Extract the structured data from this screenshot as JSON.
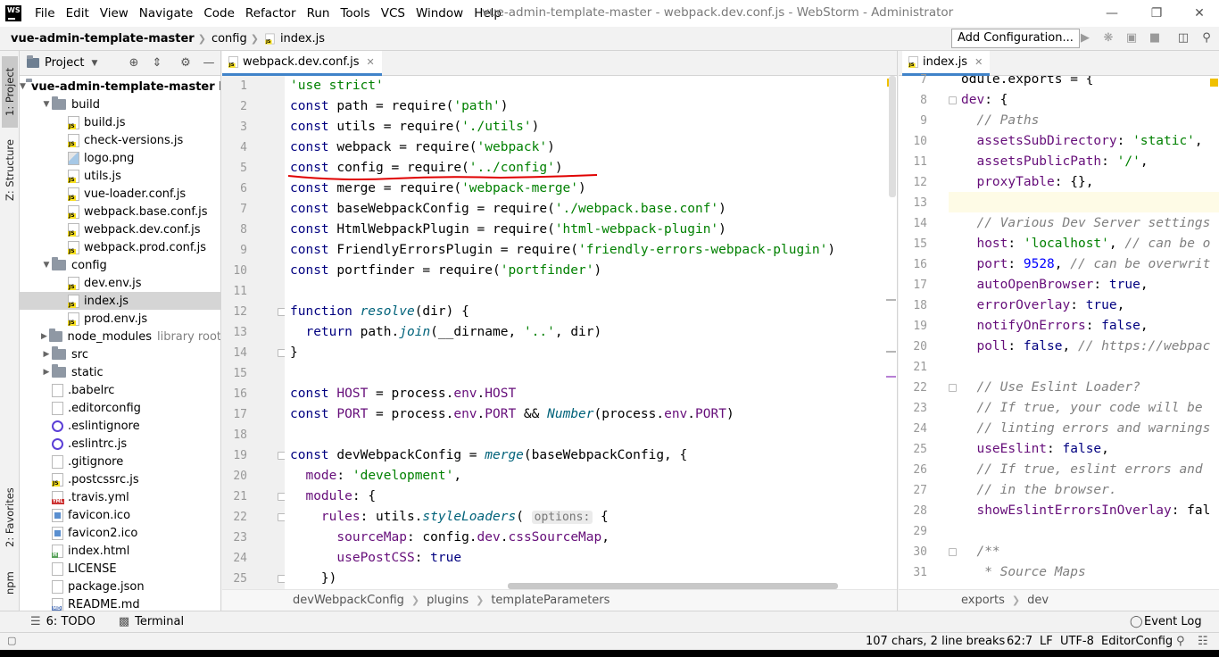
{
  "window": {
    "title": "vue-admin-template-master - webpack.dev.conf.js - WebStorm - Administrator",
    "logo_text": "WS"
  },
  "menu": [
    "File",
    "Edit",
    "View",
    "Navigate",
    "Code",
    "Refactor",
    "Run",
    "Tools",
    "VCS",
    "Window",
    "Help"
  ],
  "navbar": {
    "crumbs": [
      "vue-admin-template-master",
      "config",
      "index.js"
    ],
    "add_configuration": "Add Configuration..."
  },
  "left_strip": {
    "project_tab": "1: Project",
    "structure_tab": "Z: Structure",
    "favorites_tab": "2: Favorites",
    "npm_tab": "npm"
  },
  "project": {
    "header": "Project",
    "root": "vue-admin-template-master",
    "root_suffix": "E",
    "items": [
      {
        "label": "build",
        "type": "folder"
      },
      {
        "label": "build.js",
        "type": "js"
      },
      {
        "label": "check-versions.js",
        "type": "js"
      },
      {
        "label": "logo.png",
        "type": "img"
      },
      {
        "label": "utils.js",
        "type": "js"
      },
      {
        "label": "vue-loader.conf.js",
        "type": "js"
      },
      {
        "label": "webpack.base.conf.js",
        "type": "js"
      },
      {
        "label": "webpack.dev.conf.js",
        "type": "js"
      },
      {
        "label": "webpack.prod.conf.js",
        "type": "js"
      },
      {
        "label": "config",
        "type": "folder"
      },
      {
        "label": "dev.env.js",
        "type": "js"
      },
      {
        "label": "index.js",
        "type": "js"
      },
      {
        "label": "prod.env.js",
        "type": "js"
      },
      {
        "label": "node_modules",
        "type": "folder",
        "hint": "library root"
      },
      {
        "label": "src",
        "type": "folder"
      },
      {
        "label": "static",
        "type": "folder"
      },
      {
        "label": ".babelrc",
        "type": "file"
      },
      {
        "label": ".editorconfig",
        "type": "file"
      },
      {
        "label": ".eslintignore",
        "type": "circle"
      },
      {
        "label": ".eslintrc.js",
        "type": "circle"
      },
      {
        "label": ".gitignore",
        "type": "file"
      },
      {
        "label": ".postcssrc.js",
        "type": "js"
      },
      {
        "label": ".travis.yml",
        "type": "yml"
      },
      {
        "label": "favicon.ico",
        "type": "ico"
      },
      {
        "label": "favicon2.ico",
        "type": "ico"
      },
      {
        "label": "index.html",
        "type": "html"
      },
      {
        "label": "LICENSE",
        "type": "file"
      },
      {
        "label": "package.json",
        "type": "file"
      },
      {
        "label": "README.md",
        "type": "md"
      }
    ]
  },
  "editor": {
    "tab": "webpack.dev.conf.js",
    "line_numbers": [
      "1",
      "2",
      "3",
      "4",
      "5",
      "6",
      "7",
      "8",
      "9",
      "10",
      "11",
      "12",
      "13",
      "14",
      "15",
      "16",
      "17",
      "18",
      "19",
      "20",
      "21",
      "22",
      "23",
      "24",
      "25"
    ],
    "lines": [
      "'use strict'",
      "const path = require('path')",
      "const utils = require('./utils')",
      "const webpack = require('webpack')",
      "const config = require('../config')",
      "const merge = require('webpack-merge')",
      "const baseWebpackConfig = require('./webpack.base.conf')",
      "const HtmlWebpackPlugin = require('html-webpack-plugin')",
      "const FriendlyErrorsPlugin = require('friendly-errors-webpack-plugin')",
      "const portfinder = require('portfinder')",
      "",
      "function resolve(dir) {",
      "  return path.join(__dirname, '..', dir)",
      "}",
      "",
      "const HOST = process.env.HOST",
      "const PORT = process.env.PORT && Number(process.env.PORT)",
      "",
      "const devWebpackConfig = merge(baseWebpackConfig, {",
      "  mode: 'development',",
      "  module: {",
      "    rules: utils.styleLoaders( options: {",
      "      sourceMap: config.dev.cssSourceMap,",
      "      usePostCSS: true",
      "    })"
    ],
    "breadcrumbs": [
      "devWebpackConfig",
      "plugins",
      "templateParameters"
    ]
  },
  "right_editor": {
    "tab": "index.js",
    "line_numbers": [
      "7",
      "8",
      "9",
      "10",
      "11",
      "12",
      "13",
      "14",
      "15",
      "16",
      "17",
      "18",
      "19",
      "20",
      "21",
      "22",
      "23",
      "24",
      "25",
      "26",
      "27",
      "28",
      "29",
      "30",
      "31"
    ],
    "lines": [
      "odule.exports = {",
      "dev: {",
      "  // Paths",
      "  assetsSubDirectory: 'static',",
      "  assetsPublicPath: '/',",
      "  proxyTable: {},",
      "",
      "  // Various Dev Server settings",
      "  host: 'localhost', // can be o",
      "  port: 9528, // can be overwrit",
      "  autoOpenBrowser: true,",
      "  errorOverlay: true,",
      "  notifyOnErrors: false,",
      "  poll: false, // https://webpac",
      "",
      "  // Use Eslint Loader?",
      "  // If true, your code will be",
      "  // linting errors and warnings",
      "  useEslint: false,",
      "  // If true, eslint errors and",
      "  // in the browser.",
      "  showEslintErrorsInOverlay: fal",
      "",
      "  /**",
      "   * Source Maps"
    ],
    "breadcrumbs": [
      "exports",
      "dev"
    ]
  },
  "bottom_tools": {
    "todo": "6: TODO",
    "terminal": "Terminal",
    "event_log": "Event Log"
  },
  "status": {
    "chars": "107 chars, 2 line breaks",
    "position": "62:7",
    "line_sep": "LF",
    "encoding": "UTF-8",
    "editorconfig": "EditorConfig"
  },
  "colors": {
    "keyword": "#000080",
    "string": "#008000",
    "accent": "#4083c9",
    "annotation": "#e00000"
  }
}
